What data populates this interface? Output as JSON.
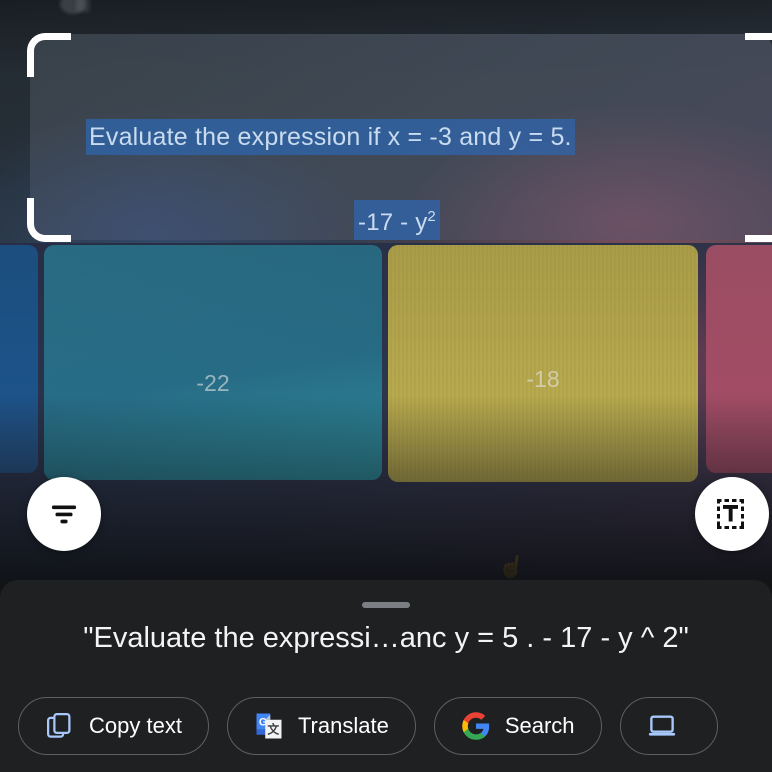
{
  "capture": {
    "ocr_line_1": "Evaluate the expression if x = -3 and y = 5.",
    "ocr_line_2_base": "-17 - y",
    "ocr_line_2_sup": "2",
    "highlight_color": "#3165ab",
    "highlight_text_color": "#cfe2f7",
    "crop_bracket_color": "#ffffff"
  },
  "cards": [
    {
      "label": "",
      "color": "#1f5c96",
      "name": "answer-card-partial-left"
    },
    {
      "label": "-22",
      "color": "#2a7793",
      "name": "answer-card-teal"
    },
    {
      "label": "-18",
      "color": "#c9b855",
      "name": "answer-card-yellow"
    },
    {
      "label": "",
      "color": "#b4546f",
      "name": "answer-card-partial-right"
    }
  ],
  "fabs": {
    "filter_icon": "filter-lines-icon",
    "select_text_icon": "select-text-icon"
  },
  "sheet": {
    "handle": "drag-handle",
    "recognized_text": "\"Evaluate the expressi…anc y = 5 . - 17 - y ^ 2\"",
    "actions": [
      {
        "label": "Copy text",
        "icon": "copy-icon",
        "name": "copy-text-button"
      },
      {
        "label": "Translate",
        "icon": "google-translate-icon",
        "name": "translate-button"
      },
      {
        "label": "Search",
        "icon": "google-g-icon",
        "name": "search-button"
      },
      {
        "label": "",
        "icon": "send-to-computer-icon",
        "name": "send-to-computer-button"
      }
    ]
  }
}
